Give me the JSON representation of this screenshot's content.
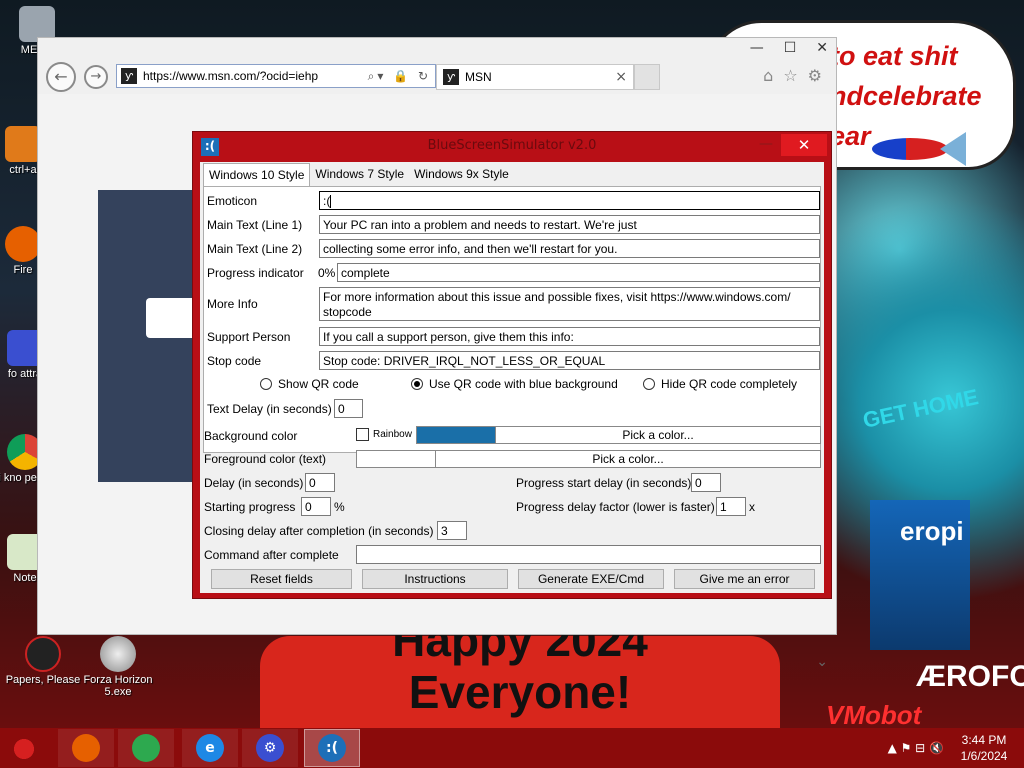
{
  "wallpaper": {
    "bubble_text": "to eat shit ndcelebrate ear",
    "banner_text": "Happy 2024 Everyone!",
    "building_text": "eropi",
    "building_text2": "ÆROFOS",
    "sign_text": "GET HOME",
    "vmo_text": "VMobot"
  },
  "desktop_icons": [
    {
      "label": "MEMZ",
      "icon": "recycle-bin-icon"
    },
    {
      "label": "ctrl+a",
      "icon": "shortcut-icon"
    },
    {
      "label": "Fire",
      "icon": "firefox-icon"
    },
    {
      "label": "fo attra",
      "icon": "gear-shortcut-icon"
    },
    {
      "label": "i kno peopl",
      "icon": "chrome-icon"
    },
    {
      "label": "Note",
      "icon": "notepad-icon"
    },
    {
      "label": "Papers, Please",
      "icon": "papers-please-icon"
    },
    {
      "label": "Forza Horizon 5.exe",
      "icon": "flash-icon"
    }
  ],
  "browser": {
    "url": "https://www.msn.com/?ocid=iehp",
    "address_tools": "⌕▾ 🔒 ↻",
    "tab_label": "MSN",
    "tab_close": "×",
    "back_icon": "←",
    "forward_icon": "→",
    "window_buttons": [
      "—",
      "☐",
      "✕"
    ],
    "tools": [
      "⌂",
      "☆",
      "⚙"
    ]
  },
  "bluescreen_app": {
    "icon_text": ":(",
    "title": "BlueScreenSimulator v2.0",
    "tabs": [
      "Windows 10 Style",
      "Windows 7 Style",
      "Windows 9x Style"
    ],
    "active_tab": "Windows 10 Style",
    "emoticon": {
      "label": "Emoticon",
      "value": ":("
    },
    "main_text_1": {
      "label": "Main Text (Line 1)",
      "value": "Your PC ran into a problem and needs to restart. We're just"
    },
    "main_text_2": {
      "label": "Main Text (Line 2)",
      "value": "collecting some error info, and then we'll restart for you."
    },
    "progress_indicator": {
      "label": "Progress indicator",
      "prefix": "0%",
      "value": "complete"
    },
    "more_info": {
      "label": "More Info",
      "value": "For more information about this issue and possible fixes, visit https://www.windows.com/ stopcode"
    },
    "support_person": {
      "label": "Support Person",
      "value": "If you call a support person, give them this info:"
    },
    "stop_code": {
      "label": "Stop code",
      "value": "Stop code: DRIVER_IRQL_NOT_LESS_OR_EQUAL"
    },
    "qr_options": [
      {
        "label": "Show QR code",
        "selected": false
      },
      {
        "label": "Use QR code with blue background",
        "selected": true
      },
      {
        "label": "Hide QR code completely",
        "selected": false
      }
    ],
    "text_delay": {
      "label": "Text Delay (in seconds)",
      "value": "0"
    },
    "background_color": {
      "label": "Background color",
      "rainbow_label": "Rainbow",
      "rainbow_checked": false,
      "swatch_color": "#1a6fa8",
      "pick_label": "Pick a color..."
    },
    "foreground_color": {
      "label": "Foreground color (text)",
      "swatch_color": "#ffffff",
      "pick_label": "Pick a color..."
    },
    "delay": {
      "label": "Delay (in seconds)",
      "value": "0"
    },
    "progress_start_delay": {
      "label": "Progress start delay (in seconds)",
      "value": "0"
    },
    "starting_progress": {
      "label": "Starting progress",
      "value": "0",
      "unit": "%"
    },
    "progress_delay_factor": {
      "label": "Progress delay factor (lower is faster)",
      "value": "1",
      "unit": "x"
    },
    "closing_delay": {
      "label": "Closing delay after completion (in seconds)",
      "value": "3"
    },
    "command_after": {
      "label": "Command after complete",
      "value": ""
    },
    "buttons": {
      "reset": "Reset fields",
      "instructions": "Instructions",
      "generate": "Generate EXE/Cmd",
      "error": "Give me an error"
    }
  },
  "taskbar": {
    "items": [
      {
        "name": "firefox",
        "icon_text": "",
        "color": "#e66000"
      },
      {
        "name": "chrome",
        "icon_text": "",
        "color": "#2da94f"
      },
      {
        "name": "ie",
        "icon_text": "e",
        "color": "#1e88e5"
      },
      {
        "name": "settings",
        "icon_text": "⚙",
        "color": "#3a4fd0"
      },
      {
        "name": "bluescreen",
        "icon_text": ":(",
        "color": "#1d6fb8"
      }
    ],
    "tray_icons": "▲ ⚑ ⊟ 🔇",
    "time": "3:44 PM",
    "date": "1/6/2024"
  },
  "colors": {
    "taskbar": "#8b0b0b",
    "app_frame": "#b80f16"
  }
}
